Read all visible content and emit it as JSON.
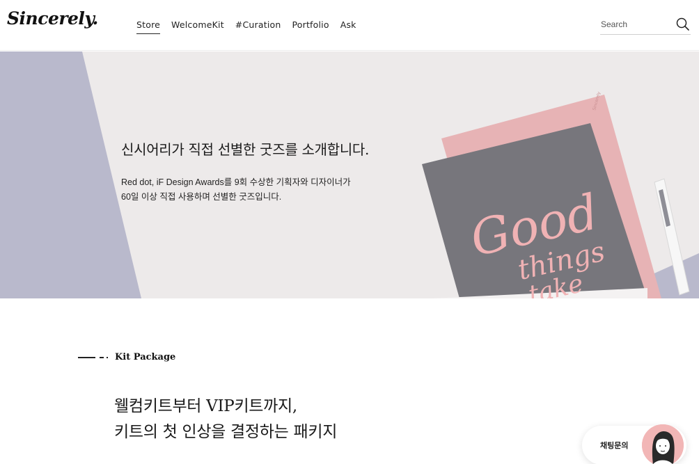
{
  "header": {
    "logo_text": "Sincerely.",
    "nav": [
      {
        "label": "Store",
        "active": true
      },
      {
        "label": "WelcomeKit",
        "active": false
      },
      {
        "label": "#Curation",
        "active": false
      },
      {
        "label": "Portfolio",
        "active": false
      },
      {
        "label": "Ask",
        "active": false
      }
    ],
    "search": {
      "placeholder": "Search",
      "icon": "search-icon"
    }
  },
  "banner": {
    "title": "신시어리가 직접 선별한 굿즈를 소개합니다.",
    "desc_line1": "Red dot, iF Design Awards를 9회 수상한 기획자와 디자이너가",
    "desc_line2": "60일 이상 직접 사용하며 선별한 굿즈입니다.",
    "notebook_text": {
      "word1": "Good",
      "word2": "things",
      "word3": "take"
    },
    "colors": {
      "lavender": "#b9b9cc",
      "paper": "#edeaea",
      "pink": "#e7b3b5",
      "gray_cover": "#77767c",
      "lettering": "#f0b2b4"
    }
  },
  "section": {
    "eyebrow": "Kit Package",
    "headline_line1": "웰컴키트부터 VIP키트까지,",
    "headline_line2": "키트의 첫 인상을 결정하는 패키지"
  },
  "chat": {
    "label": "채팅문의",
    "avatar_icon": "agent-avatar-icon",
    "avatar_bg": "#f2b6b6"
  }
}
